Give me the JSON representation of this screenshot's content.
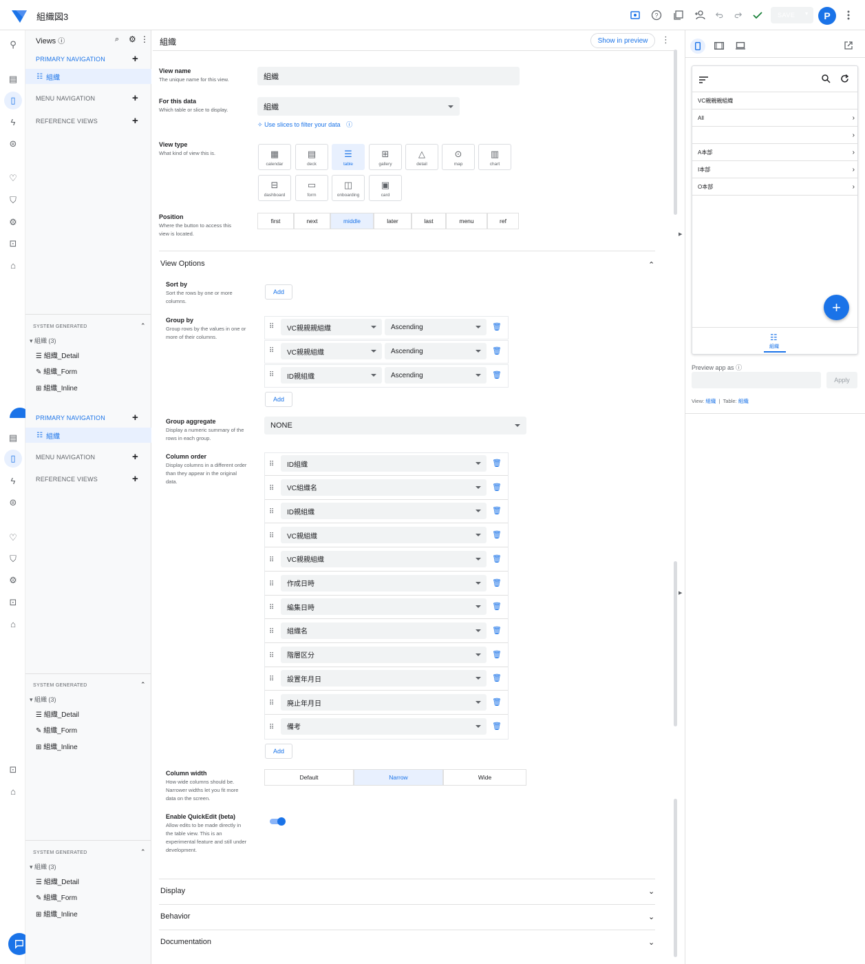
{
  "app": {
    "title": "組織図3",
    "save_label": "SAVE",
    "avatar_letter": "P",
    "accent": "#1a73e8"
  },
  "nav": {
    "views_title": "Views",
    "groups": [
      {
        "primary": "PRIMARY NAVIGATION",
        "primary_item": "組織",
        "menu": "MENU NAVIGATION",
        "reference": "REFERENCE VIEWS",
        "system": "SYSTEM GENERATED",
        "table": "組織 (3)",
        "items": [
          "組織_Detail",
          "組織_Form",
          "組織_Inline"
        ]
      },
      {
        "primary": "PRIMARY NAVIGATION",
        "primary_item": "組織",
        "menu": "MENU NAVIGATION",
        "reference": "REFERENCE VIEWS",
        "system": "SYSTEM GENERATED",
        "table": "組織 (3)",
        "items": [
          "組織_Detail",
          "組織_Form",
          "組織_Inline"
        ]
      },
      {
        "system": "SYSTEM GENERATED",
        "table": "組織 (3)",
        "items": [
          "組織_Detail",
          "組織_Form",
          "組織_Inline"
        ]
      }
    ]
  },
  "main": {
    "title": "組織",
    "show_in_preview": "Show in preview",
    "view_name": {
      "label": "View name",
      "sub": "The unique name for this view.",
      "value": "組織"
    },
    "for_data": {
      "label": "For this data",
      "sub": "Which table or slice to display.",
      "value": "組織",
      "slice_link": "Use slices to filter your data"
    },
    "view_type": {
      "label": "View type",
      "sub": "What kind of view this is.",
      "types": [
        "calendar",
        "deck",
        "table",
        "gallery",
        "detail",
        "map",
        "chart",
        "dashboard",
        "form",
        "onboarding",
        "card"
      ],
      "selected": "table"
    },
    "position": {
      "label": "Position",
      "sub1": "Where the button to access this",
      "sub2": "view is located.",
      "options": [
        "first",
        "next",
        "middle",
        "later",
        "last",
        "menu",
        "ref"
      ],
      "selected": "middle"
    },
    "view_options": "View Options",
    "sort_by": {
      "label": "Sort by",
      "sub1": "Sort the rows by one or more",
      "sub2": "columns.",
      "add": "Add"
    },
    "group_by": {
      "label": "Group by",
      "sub1": "Group rows by the values in one or",
      "sub2": "more of their columns.",
      "rows": [
        {
          "column": "VC親親親組織",
          "order": "Ascending"
        },
        {
          "column": "VC親親組織",
          "order": "Ascending"
        },
        {
          "column": "ID親組織",
          "order": "Ascending"
        }
      ],
      "add": "Add"
    },
    "group_aggregate": {
      "label": "Group aggregate",
      "sub1": "Display a numeric summary of the",
      "sub2": "rows in each group.",
      "value": "NONE"
    },
    "column_order": {
      "label": "Column order",
      "sub1": "Display columns in a different order",
      "sub2": "than they appear in the original",
      "sub3": "data.",
      "columns": [
        "ID組織",
        "VC組織名",
        "ID親組織",
        "VC親組織",
        "VC親親組織",
        "作成日時",
        "編集日時",
        "組織名",
        "階層区分",
        "設置年月日",
        "廃止年月日",
        "備考"
      ],
      "add": "Add"
    },
    "column_width": {
      "label": "Column width",
      "sub1": "How wide columns should be.",
      "sub2": "Narrower widths let you fit more",
      "sub3": "data on the screen.",
      "options": [
        "Default",
        "Narrow",
        "Wide"
      ],
      "selected": "Narrow"
    },
    "quickedit": {
      "label": "Enable QuickEdit (beta)",
      "sub1": "Allow edits to be made directly in",
      "sub2": "the table view. This is an",
      "sub3": "experimental feature and still under",
      "sub4": "development.",
      "enabled": true
    },
    "sections": [
      "Display",
      "Behavior",
      "Documentation"
    ]
  },
  "preview": {
    "header": "VC親親親組織",
    "rows": [
      "All",
      "",
      "A本部",
      "I本部",
      "O本部"
    ],
    "tab_label": "組織",
    "preview_as": "Preview app as",
    "apply": "Apply",
    "view_label": "View:",
    "view_value": "組織",
    "table_label": "Table:",
    "table_value": "組織",
    "separator": "|"
  }
}
